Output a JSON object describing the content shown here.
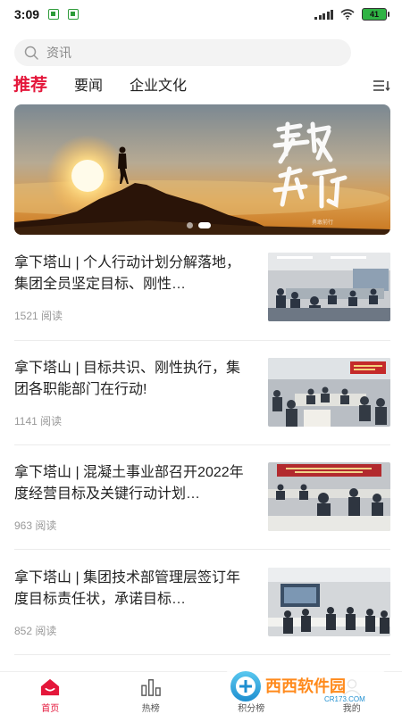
{
  "status_bar": {
    "time": "3:09",
    "battery": "41"
  },
  "search": {
    "placeholder": "资讯"
  },
  "tabs": [
    {
      "label": "推荐",
      "active": true
    },
    {
      "label": "要闻",
      "active": false
    },
    {
      "label": "企业文化",
      "active": false
    }
  ],
  "banner": {
    "calligraphy": "勇敢前行",
    "slide_count": 2,
    "active_slide": 2
  },
  "articles": [
    {
      "title": "拿下塔山 | 个人行动计划分解落地，集团全员坚定目标、刚性…",
      "reads": "1521 阅读"
    },
    {
      "title": "拿下塔山 | 目标共识、刚性执行，集团各职能部门在行动!",
      "reads": "1141 阅读"
    },
    {
      "title": "拿下塔山 | 混凝土事业部召开2022年度经营目标及关键行动计划…",
      "reads": "963 阅读"
    },
    {
      "title": "拿下塔山 | 集团技术部管理层签订年度目标责任状，承诺目标…",
      "reads": "852 阅读"
    }
  ],
  "bottom_nav": [
    {
      "label": "首页",
      "icon": "home-icon",
      "active": true
    },
    {
      "label": "热榜",
      "icon": "bar-chart-icon",
      "active": false
    },
    {
      "label": "积分榜",
      "icon": "trophy-icon",
      "active": false
    },
    {
      "label": "我的",
      "icon": "user-icon",
      "active": false
    }
  ],
  "watermark": {
    "text": "西西软件园",
    "domain": "CR173.COM"
  },
  "colors": {
    "accent": "#e4173b",
    "text": "#222222",
    "meta": "#999999"
  }
}
